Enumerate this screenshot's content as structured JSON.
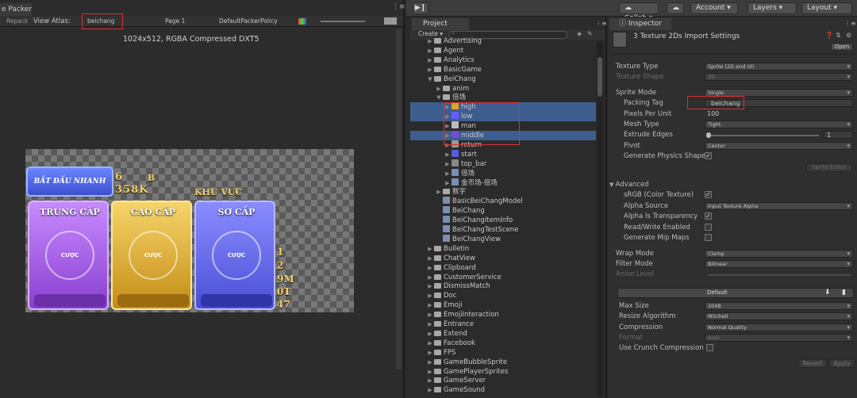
{
  "topbar": {
    "collab": "Collab",
    "account": "Account",
    "layers": "Layers",
    "layout": "Layout"
  },
  "packer": {
    "tab": "e Packer",
    "toolbar": {
      "repack": "Repack",
      "view_atlas_label": "View Atlas:",
      "atlas_value": "beichang",
      "page": "Page 1",
      "policy": "DefaultPackerPolicy"
    },
    "texture_info": "1024x512, RGBA Compressed DXT5",
    "atlas": {
      "start_button": "BẮT ĐẦU NHANH",
      "region_label": "KHU VỰC",
      "cards": [
        {
          "title": "TRUNG CẤP",
          "bet": "CƯỢC",
          "color": "#9b59d6"
        },
        {
          "title": "CAO CẤP",
          "bet": "CƯỢC",
          "color": "#d9a82b"
        },
        {
          "title": "SƠ CẤP",
          "bet": "CƯỢC",
          "color": "#5b5fe0"
        }
      ],
      "digits": [
        "6",
        "B",
        "358K",
        "1",
        "2",
        "9M",
        "0T",
        "47"
      ]
    }
  },
  "project": {
    "tab": "Project",
    "create": "Create",
    "items": [
      {
        "label": "Advertising",
        "indent": 0,
        "type": "folder"
      },
      {
        "label": "Agent",
        "indent": 0,
        "type": "folder"
      },
      {
        "label": "Analytics",
        "indent": 0,
        "type": "folder"
      },
      {
        "label": "BasicGame",
        "indent": 0,
        "type": "folder"
      },
      {
        "label": "BeiChang",
        "indent": 0,
        "type": "folder-open"
      },
      {
        "label": "anim",
        "indent": 1,
        "type": "folder"
      },
      {
        "label": "倍场",
        "indent": 1,
        "type": "folder-open"
      },
      {
        "label": "high",
        "indent": 2,
        "type": "asset",
        "selected": true
      },
      {
        "label": "low",
        "indent": 2,
        "type": "asset",
        "selected": true
      },
      {
        "label": "man",
        "indent": 2,
        "type": "asset"
      },
      {
        "label": "middle",
        "indent": 2,
        "type": "asset",
        "selected": true
      },
      {
        "label": "return",
        "indent": 2,
        "type": "asset"
      },
      {
        "label": "start",
        "indent": 2,
        "type": "asset"
      },
      {
        "label": "top_bar",
        "indent": 2,
        "type": "asset"
      },
      {
        "label": "倍场",
        "indent": 2,
        "type": "asset"
      },
      {
        "label": "金币场-倍场",
        "indent": 2,
        "type": "asset"
      },
      {
        "label": "数字",
        "indent": 1,
        "type": "folder"
      },
      {
        "label": "BasicBeiChangModel",
        "indent": 1,
        "type": "file"
      },
      {
        "label": "BeiChang",
        "indent": 1,
        "type": "file"
      },
      {
        "label": "BeiChangItemInfo",
        "indent": 1,
        "type": "file"
      },
      {
        "label": "BeiChangTestScene",
        "indent": 1,
        "type": "file"
      },
      {
        "label": "BeiChangView",
        "indent": 1,
        "type": "file"
      },
      {
        "label": "Bulletin",
        "indent": 0,
        "type": "folder"
      },
      {
        "label": "ChatView",
        "indent": 0,
        "type": "folder"
      },
      {
        "label": "Clipboard",
        "indent": 0,
        "type": "folder"
      },
      {
        "label": "CustomerService",
        "indent": 0,
        "type": "folder"
      },
      {
        "label": "DismissMatch",
        "indent": 0,
        "type": "folder"
      },
      {
        "label": "Doc",
        "indent": 0,
        "type": "folder"
      },
      {
        "label": "Emoji",
        "indent": 0,
        "type": "folder"
      },
      {
        "label": "EmojiInteraction",
        "indent": 0,
        "type": "folder"
      },
      {
        "label": "Entrance",
        "indent": 0,
        "type": "folder"
      },
      {
        "label": "Extend",
        "indent": 0,
        "type": "folder"
      },
      {
        "label": "Facebook",
        "indent": 0,
        "type": "folder"
      },
      {
        "label": "FPS",
        "indent": 0,
        "type": "folder"
      },
      {
        "label": "GameBubbleSprite",
        "indent": 0,
        "type": "folder"
      },
      {
        "label": "GamePlayerSprites",
        "indent": 0,
        "type": "folder"
      },
      {
        "label": "GameServer",
        "indent": 0,
        "type": "folder"
      },
      {
        "label": "GameSound",
        "indent": 0,
        "type": "folder"
      }
    ]
  },
  "inspector": {
    "tab": "Inspector",
    "title": "3 Texture 2Ds Import Settings",
    "open": "Open",
    "texture_type_label": "Texture Type",
    "texture_type": "Sprite (2D and UI)",
    "texture_shape_label": "Texture Shape",
    "texture_shape": "2D",
    "sprite_mode_label": "Sprite Mode",
    "sprite_mode": "Single",
    "packing_tag_label": "Packing Tag",
    "packing_tag": "beichang",
    "ppu_label": "Pixels Per Unit",
    "ppu": "100",
    "mesh_type_label": "Mesh Type",
    "mesh_type": "Tight",
    "extrude_label": "Extrude Edges",
    "extrude": "1",
    "pivot_label": "Pivot",
    "pivot": "Center",
    "physics_label": "Generate Physics Shape",
    "sprite_editor": "Sprite Editor",
    "advanced": "Advanced",
    "srgb_label": "sRGB (Color Texture)",
    "alpha_source_label": "Alpha Source",
    "alpha_source": "Input Texture Alpha",
    "alpha_trans_label": "Alpha Is Transparency",
    "readwrite_label": "Read/Write Enabled",
    "mipmaps_label": "Generate Mip Maps",
    "wrap_label": "Wrap Mode",
    "wrap": "Clamp",
    "filter_label": "Filter Mode",
    "filter": "Bilinear",
    "aniso_label": "Aniso Level",
    "platform": "Default",
    "maxsize_label": "Max Size",
    "maxsize": "2048",
    "resize_label": "Resize Algorithm",
    "resize": "Mitchell",
    "compression_label": "Compression",
    "compression": "Normal Quality",
    "format_label": "Format",
    "format": "Auto",
    "crunch_label": "Use Crunch Compression",
    "revert": "Revert",
    "apply": "Apply"
  }
}
